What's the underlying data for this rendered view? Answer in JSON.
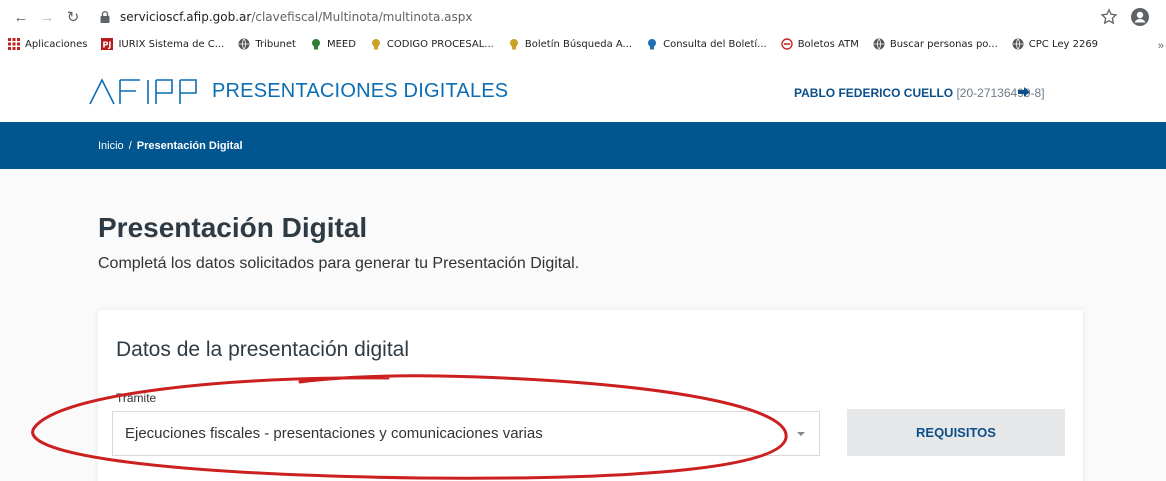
{
  "browser": {
    "url_host": "servicioscf.afip.gob.ar",
    "url_path": "/clavefiscal/Multinota/multinota.aspx",
    "bookmarks": [
      {
        "label": "Aplicaciones",
        "icon": "apps-grid-icon",
        "color": "#c5221f"
      },
      {
        "label": "IURIX Sistema de C...",
        "icon": "pj-icon",
        "color": "#b71c1c"
      },
      {
        "label": "Tribunet",
        "icon": "globe-icon",
        "color": "#555555"
      },
      {
        "label": "MEED",
        "icon": "meed-icon",
        "color": "#2e7d32"
      },
      {
        "label": "CODIGO PROCESAL...",
        "icon": "codigo-icon",
        "color": "#c9a227"
      },
      {
        "label": "Boletín Búsqueda A...",
        "icon": "boletin-icon",
        "color": "#c9a227"
      },
      {
        "label": "Consulta del Boletí...",
        "icon": "boletin-icon",
        "color": "#1f6fb2"
      },
      {
        "label": "Boletos ATM",
        "icon": "atm-icon",
        "color": "#c62828"
      },
      {
        "label": "Buscar personas po...",
        "icon": "globe-icon",
        "color": "#555555"
      },
      {
        "label": "CPC Ley 2269",
        "icon": "globe-icon",
        "color": "#555555"
      }
    ],
    "more": "»"
  },
  "header": {
    "site_title": "PRESENTACIONES DIGITALES",
    "user_name": "PABLO FEDERICO CUELLO",
    "user_cuit": "[20-27136499-8]"
  },
  "breadcrumb": {
    "home": "Inicio",
    "separator": "/",
    "current": "Presentación Digital"
  },
  "main": {
    "title": "Presentación Digital",
    "subtitle": "Completá los datos solicitados para generar tu Presentación Digital."
  },
  "form": {
    "card_title": "Datos de la presentación digital",
    "tramite_label": "Trámite",
    "tramite_value": "Ejecuciones fiscales - presentaciones y comunicaciones varias",
    "requisitos_label": "REQUISITOS"
  },
  "colors": {
    "brand_blue": "#02568f",
    "title_blue": "#0b6db3",
    "annotation_red": "#cc1f1f"
  }
}
